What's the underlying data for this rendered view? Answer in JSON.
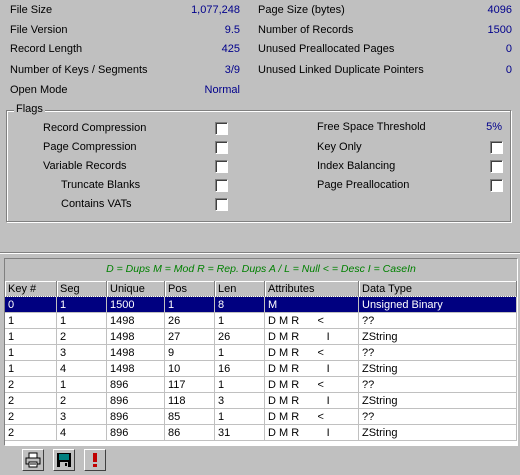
{
  "stats_left": [
    {
      "label": "File Size",
      "value": "1,077,248"
    },
    {
      "label": "File Version",
      "value": "9.5"
    },
    {
      "label": "Record Length",
      "value": "425"
    },
    {
      "label": "Number of Keys / Segments",
      "value": "3/9"
    },
    {
      "label": "Open Mode",
      "value": "Normal"
    }
  ],
  "stats_right": [
    {
      "label": "Page Size (bytes)",
      "value": "4096"
    },
    {
      "label": "Number of Records",
      "value": "1500"
    },
    {
      "label": "Unused Preallocated Pages",
      "value": "0"
    },
    {
      "label": "Unused Linked Duplicate Pointers",
      "value": "0"
    }
  ],
  "flags": {
    "title": "Flags",
    "left": [
      {
        "label": "Record Compression"
      },
      {
        "label": "Page Compression"
      },
      {
        "label": "Variable Records"
      },
      {
        "label": "Truncate Blanks"
      },
      {
        "label": "Contains VATs"
      }
    ],
    "right_threshold": {
      "label": "Free Space Threshold",
      "value": "5%"
    },
    "right": [
      {
        "label": "Key Only"
      },
      {
        "label": "Index Balancing"
      },
      {
        "label": "Page Preallocation"
      }
    ]
  },
  "grid": {
    "legend": "D = Dups   M = Mod   R = Rep. Dups   A / L = Null   < = Desc   I = CaseIn",
    "columns": [
      "Key #",
      "Seg",
      "Unique",
      "Pos",
      "Len",
      "Attributes",
      "Data Type"
    ],
    "rows": [
      [
        "0",
        "1",
        "1500",
        "1",
        "8",
        "M",
        "Unsigned Binary"
      ],
      [
        "1",
        "1",
        "1498",
        "26",
        "1",
        "D M R      <",
        "??"
      ],
      [
        "1",
        "2",
        "1498",
        "27",
        "26",
        "D M R         I",
        "ZString"
      ],
      [
        "1",
        "3",
        "1498",
        "9",
        "1",
        "D M R      <",
        "??"
      ],
      [
        "1",
        "4",
        "1498",
        "10",
        "16",
        "D M R         I",
        "ZString"
      ],
      [
        "2",
        "1",
        "896",
        "117",
        "1",
        "D M R      <",
        "??"
      ],
      [
        "2",
        "2",
        "896",
        "118",
        "3",
        "D M R         I",
        "ZString"
      ],
      [
        "2",
        "3",
        "896",
        "85",
        "1",
        "D M R      <",
        "??"
      ],
      [
        "2",
        "4",
        "896",
        "86",
        "31",
        "D M R         I",
        "ZString"
      ]
    ]
  },
  "toolbar": [
    {
      "icon": "printer-icon"
    },
    {
      "icon": "save-icon"
    },
    {
      "icon": "exclamation-icon"
    }
  ]
}
